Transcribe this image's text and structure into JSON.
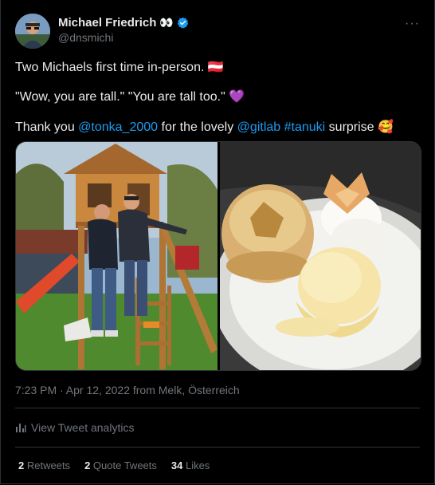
{
  "author": {
    "name": "Michael Friedrich",
    "name_emoji": "👀",
    "handle": "@dnsmichi"
  },
  "tweet": {
    "line1_text": "Two Michaels first time in-person.",
    "line1_emoji": "🇦🇹",
    "line2_text": "\"Wow, you are tall.\" \"You are tall too.\"",
    "line2_emoji": "💜",
    "line3_prefix": "Thank you",
    "mention1": "@tonka_2000",
    "line3_middle": "for the lovely",
    "mention2": "@gitlab",
    "hashtag": "#tanuki",
    "line3_suffix": "surprise",
    "line3_emoji": "🥰"
  },
  "meta": {
    "timestamp": "7:23 PM · Apr 12, 2022 from Melk, Österreich"
  },
  "analytics": {
    "label": "View Tweet analytics"
  },
  "stats": {
    "retweets_count": "2",
    "retweets_label": "Retweets",
    "quotes_count": "2",
    "quotes_label": "Quote Tweets",
    "likes_count": "34",
    "likes_label": "Likes"
  },
  "icons": {
    "verified": "verified-badge-icon",
    "more": "more-options-icon",
    "analytics": "analytics-bar-icon"
  },
  "colors": {
    "link": "#1d9bf0",
    "verified": "#1d9bf0",
    "secondary_text": "#71767b",
    "background": "#000000"
  }
}
